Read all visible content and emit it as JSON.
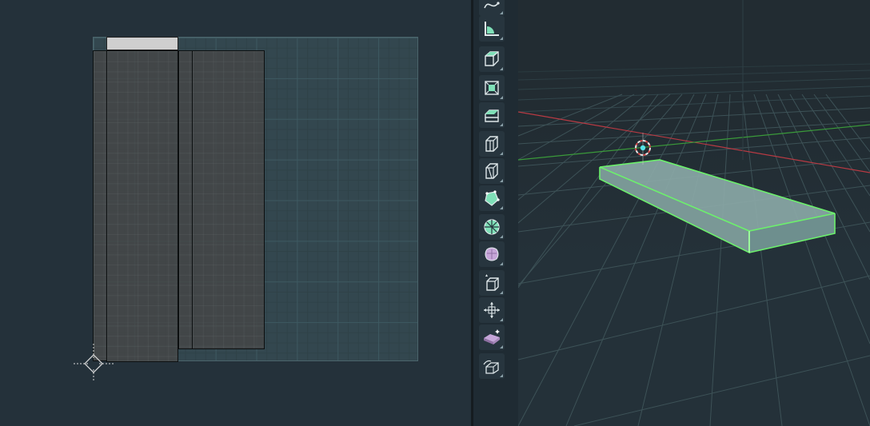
{
  "uv_editor": {
    "islands": [
      {
        "name": "uv-island-top-strip",
        "selected": true
      },
      {
        "name": "uv-island-left-strip",
        "selected": false
      },
      {
        "name": "uv-island-center-left",
        "selected": false
      },
      {
        "name": "uv-island-narrow-strip",
        "selected": false
      },
      {
        "name": "uv-island-center-right",
        "selected": false
      }
    ],
    "cursor_icon": "2d-cursor-icon"
  },
  "toolbar": {
    "tools": [
      {
        "name": "annotate-tool",
        "icon": "annotate-icon"
      },
      {
        "name": "measure-tool",
        "icon": "measure-icon"
      },
      {
        "name": "add-cube-tool",
        "icon": "add-cube-icon"
      },
      {
        "name": "extrude-region-tool",
        "icon": "extrude-region-icon"
      },
      {
        "name": "inset-faces-tool",
        "icon": "inset-faces-icon"
      },
      {
        "name": "bevel-tool",
        "icon": "bevel-icon"
      },
      {
        "name": "loop-cut-tool",
        "icon": "loop-cut-icon"
      },
      {
        "name": "knife-tool",
        "icon": "knife-icon"
      },
      {
        "name": "poly-build-tool",
        "icon": "poly-build-icon"
      },
      {
        "name": "spin-tool",
        "icon": "spin-icon"
      },
      {
        "name": "smooth-tool",
        "icon": "smooth-icon"
      },
      {
        "name": "edge-slide-tool",
        "icon": "edge-slide-icon"
      },
      {
        "name": "shrink-fatten-tool",
        "icon": "shrink-fatten-icon"
      },
      {
        "name": "shear-tool",
        "icon": "shear-icon"
      },
      {
        "name": "rip-region-tool",
        "icon": "rip-region-icon"
      }
    ]
  },
  "viewport": {
    "object": "selected-slab-mesh",
    "colors": {
      "x_axis": "#b83a43",
      "y_axis": "#3a9a3a",
      "selection_outline": "#6cf06c",
      "mesh_face": "#8aa8a6"
    },
    "cursor_icon": "3d-cursor-icon"
  }
}
